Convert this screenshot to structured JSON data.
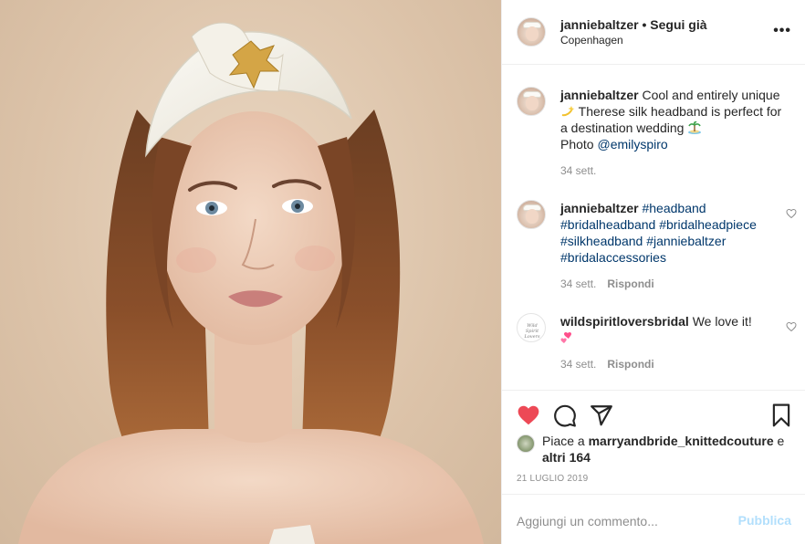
{
  "header": {
    "username": "janniebaltzer",
    "separator": " • ",
    "follow_status": "Segui già",
    "location": "Copenhagen",
    "more_label": "•••"
  },
  "caption": {
    "username": "janniebaltzer",
    "text_1": " Cool and entirely unique ",
    "emoji_1": "dizzy-emoji",
    "text_2": " Therese silk headband is perfect for a destination wedding ",
    "emoji_2": "desert-island-emoji",
    "photo_label": "Photo ",
    "mention": "@emilyspiro",
    "time": "34 sett."
  },
  "comments": [
    {
      "username": "janniebaltzer",
      "hashtags": [
        "#headband",
        "#bridalheadband",
        "#bridalheadpiece",
        "#silkheadband",
        "#janniebaltzer",
        "#bridalaccessories"
      ],
      "time": "34 sett.",
      "reply_label": "Rispondi"
    },
    {
      "username": "wildspiritloversbridal",
      "text": " We love it!",
      "emoji": "two-hearts-emoji",
      "time": "34 sett.",
      "reply_label": "Rispondi",
      "avatar_text": "Wild Spirit Lovers"
    }
  ],
  "likes": {
    "prefix": "Piace a ",
    "user": "marryandbride_knittedcouture",
    "suffix": " e",
    "others": "altri 164"
  },
  "date": "21 LUGLIO 2019",
  "add_comment": {
    "placeholder": "Aggiungi un commento...",
    "publish_label": "Pubblica"
  },
  "colors": {
    "like_red": "#ed4956",
    "link_blue": "#00376b",
    "publish_disabled": "#b2dffc",
    "muted": "#8e8e8e"
  }
}
